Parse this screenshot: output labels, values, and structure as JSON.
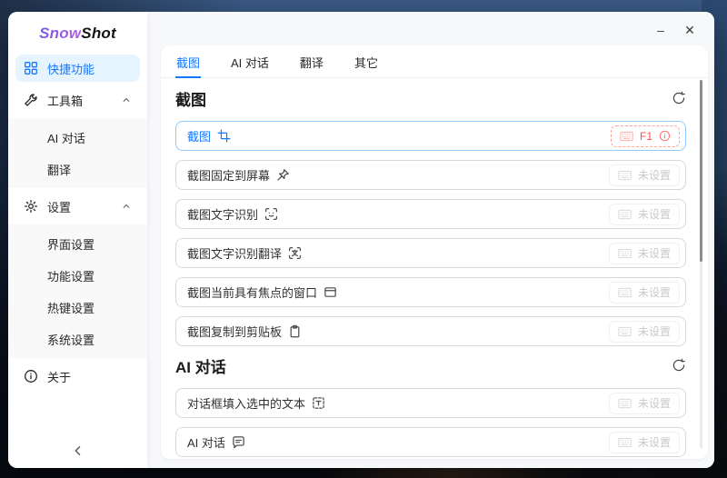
{
  "colors": {
    "accent": "#1677ff",
    "accent_bg": "#e6f4ff",
    "accent_border": "#91caff",
    "danger": "#ff4d4f",
    "danger_border": "#ffa39e",
    "logo_purple": "#9254de"
  },
  "window_controls": [
    {
      "name": "minimize",
      "glyph": "–"
    },
    {
      "name": "close",
      "glyph": "✕"
    }
  ],
  "sidebar": {
    "logo": {
      "snow": "Snow",
      "shot": "Shot"
    },
    "menu": [
      {
        "id": "quick-actions",
        "label": "快捷功能",
        "icon": "grid-icon",
        "active": true
      },
      {
        "id": "toolbox",
        "label": "工具箱",
        "icon": "tool-icon",
        "expanded": true,
        "children": [
          {
            "id": "ai-chat",
            "label": "AI 对话"
          },
          {
            "id": "translate",
            "label": "翻译"
          }
        ]
      },
      {
        "id": "settings",
        "label": "设置",
        "icon": "gear-icon",
        "expanded": true,
        "children": [
          {
            "id": "ui-settings",
            "label": "界面设置"
          },
          {
            "id": "function-settings",
            "label": "功能设置"
          },
          {
            "id": "hotkey-settings",
            "label": "热键设置"
          },
          {
            "id": "system-settings",
            "label": "系统设置"
          }
        ]
      },
      {
        "id": "about",
        "label": "关于",
        "icon": "info-icon"
      }
    ],
    "collapse_icon": "chevron-left-icon"
  },
  "tabs": [
    {
      "id": "screenshot",
      "label": "截图",
      "active": true
    },
    {
      "id": "ai-chat",
      "label": "AI 对话",
      "active": false
    },
    {
      "id": "translate",
      "label": "翻译",
      "active": false
    },
    {
      "id": "other",
      "label": "其它",
      "active": false
    }
  ],
  "sections": [
    {
      "id": "screenshot",
      "title": "截图",
      "reset_icon": "sync-icon",
      "rows": [
        {
          "id": "screenshot",
          "label": "截图",
          "icon": "crop-icon",
          "primary": true,
          "hotkey": {
            "keyboard_icon": "keyboard-icon",
            "key": "F1",
            "info_icon": "info-circle-icon"
          }
        },
        {
          "id": "fix-to-screen",
          "label": "截图固定到屏幕",
          "icon": "pin-icon",
          "badge": {
            "keyboard_icon": "keyboard-icon",
            "text": "未设置"
          }
        },
        {
          "id": "ocr",
          "label": "截图文字识别",
          "icon": "ocr-icon",
          "badge": {
            "keyboard_icon": "keyboard-icon",
            "text": "未设置"
          }
        },
        {
          "id": "ocr-translate",
          "label": "截图文字识别翻译",
          "icon": "ocr-translate-icon",
          "badge": {
            "keyboard_icon": "keyboard-icon",
            "text": "未设置"
          }
        },
        {
          "id": "focused-window",
          "label": "截图当前具有焦点的窗口",
          "icon": "window-icon",
          "badge": {
            "keyboard_icon": "keyboard-icon",
            "text": "未设置"
          }
        },
        {
          "id": "copy-to-clipboard",
          "label": "截图复制到剪贴板",
          "icon": "clipboard-icon",
          "badge": {
            "keyboard_icon": "keyboard-icon",
            "text": "未设置"
          }
        }
      ]
    },
    {
      "id": "ai-chat",
      "title": "AI 对话",
      "reset_icon": "sync-icon",
      "rows": [
        {
          "id": "fill-selected-text",
          "label": "对话框填入选中的文本",
          "icon": "text-select-icon",
          "badge": {
            "keyboard_icon": "keyboard-icon",
            "text": "未设置"
          }
        },
        {
          "id": "ai-chat",
          "label": "AI 对话",
          "icon": "chat-icon",
          "badge": {
            "keyboard_icon": "keyboard-icon",
            "text": "未设置"
          }
        }
      ]
    }
  ]
}
